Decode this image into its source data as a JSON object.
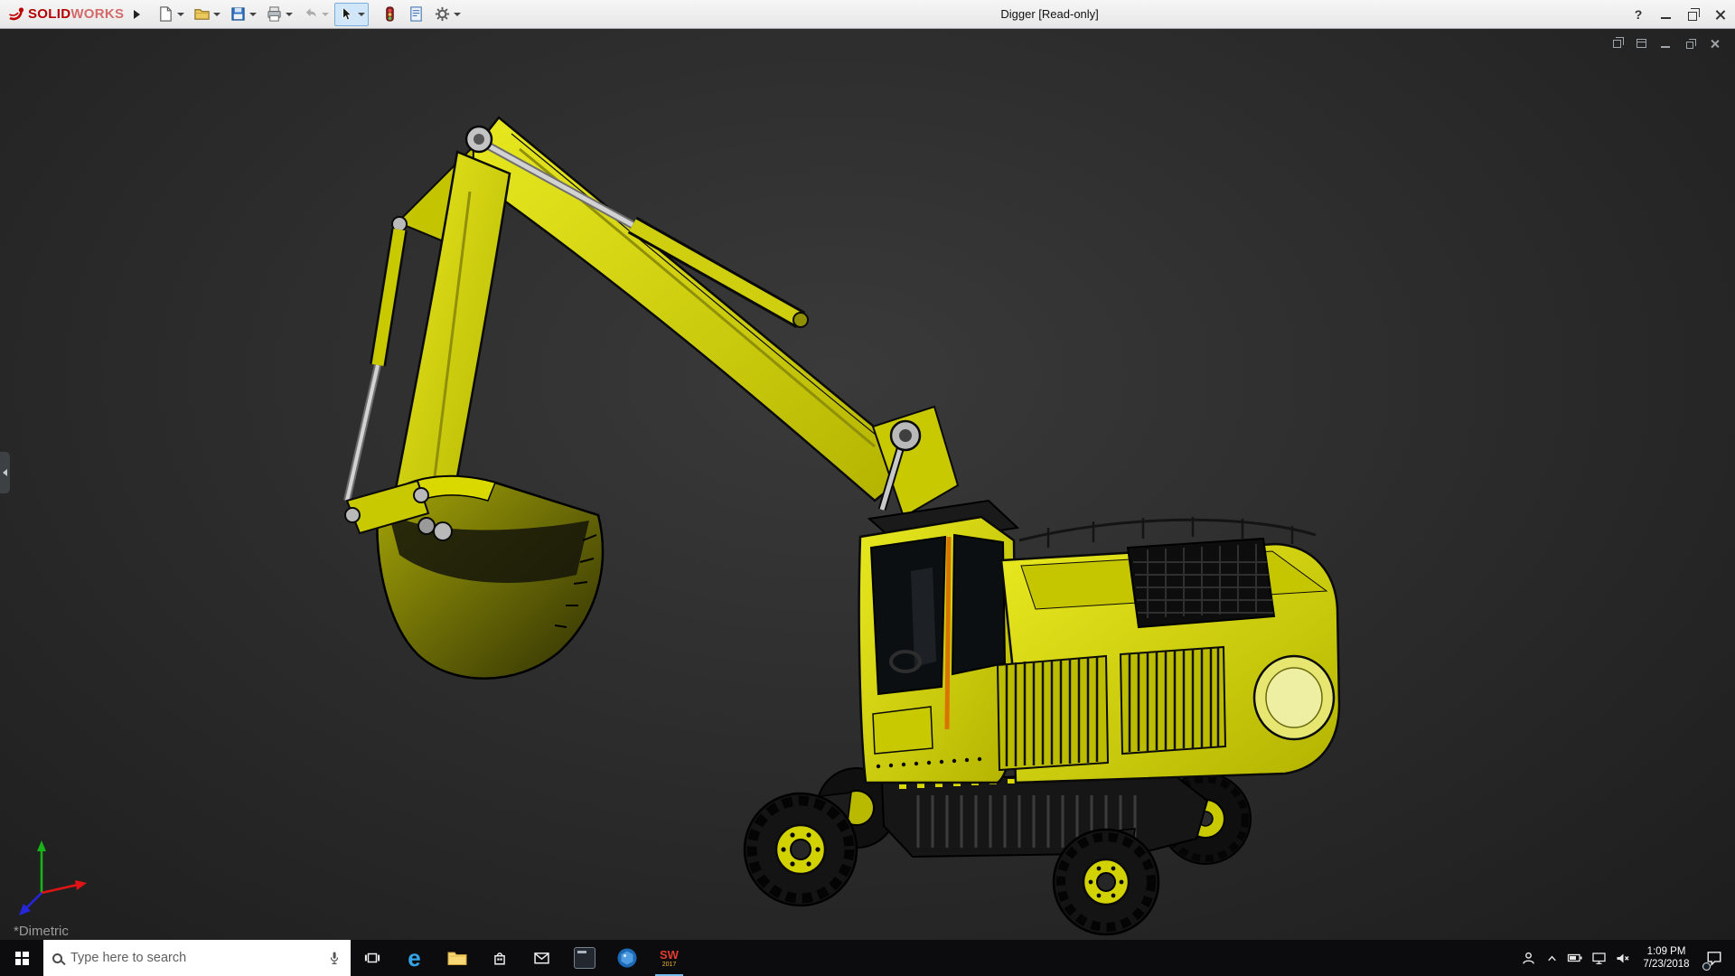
{
  "app": {
    "brand_bold": "SOLID",
    "brand_light": "WORKS",
    "window_title": "Digger [Read-only]"
  },
  "titlebar": {
    "help_glyph": "?",
    "window_buttons": [
      "minimize",
      "restore",
      "close"
    ]
  },
  "toolbar": {
    "buttons": [
      {
        "name": "new-document",
        "dropdown": true,
        "enabled": true
      },
      {
        "name": "open",
        "dropdown": true,
        "enabled": true
      },
      {
        "name": "save",
        "dropdown": true,
        "enabled": true
      },
      {
        "name": "print",
        "dropdown": true,
        "enabled": true
      },
      {
        "name": "undo",
        "dropdown": true,
        "enabled": false
      },
      {
        "name": "select",
        "dropdown": true,
        "enabled": true,
        "active": true
      },
      {
        "name": "rebuild",
        "dropdown": false,
        "enabled": true
      },
      {
        "name": "file-properties",
        "dropdown": false,
        "enabled": true
      },
      {
        "name": "options",
        "dropdown": true,
        "enabled": true
      }
    ]
  },
  "viewport": {
    "orientation_label": "*Dimetric",
    "document_controls": [
      "cascade",
      "tile",
      "minimize",
      "restore",
      "close"
    ],
    "triad_axes": [
      "x-red",
      "y-green",
      "z-blue"
    ],
    "background_center": "#3a3a3a",
    "background_edge": "#1d1d1d"
  },
  "model": {
    "subject": "yellow wheeled excavator",
    "body_color": "#d9d900",
    "edge_color": "#0a0a0a",
    "hydraulic_color": "#c8c8c8",
    "window_color": "#0c0f12"
  },
  "taskbar": {
    "search_placeholder": "Type here to search",
    "edge_glyph": "e",
    "solidworks_icon": {
      "letters": "SW",
      "year": "2017"
    },
    "apps": [
      "task-view",
      "edge",
      "file-explorer",
      "store",
      "mail",
      "dark-window-app",
      "blue-sphere-app",
      "solidworks-2017"
    ],
    "tray": {
      "time": "1:09 PM",
      "date": "7/23/2018",
      "icons": [
        "people",
        "hidden-icons-chevron",
        "battery",
        "display",
        "volume-muted",
        "action-center"
      ]
    }
  }
}
